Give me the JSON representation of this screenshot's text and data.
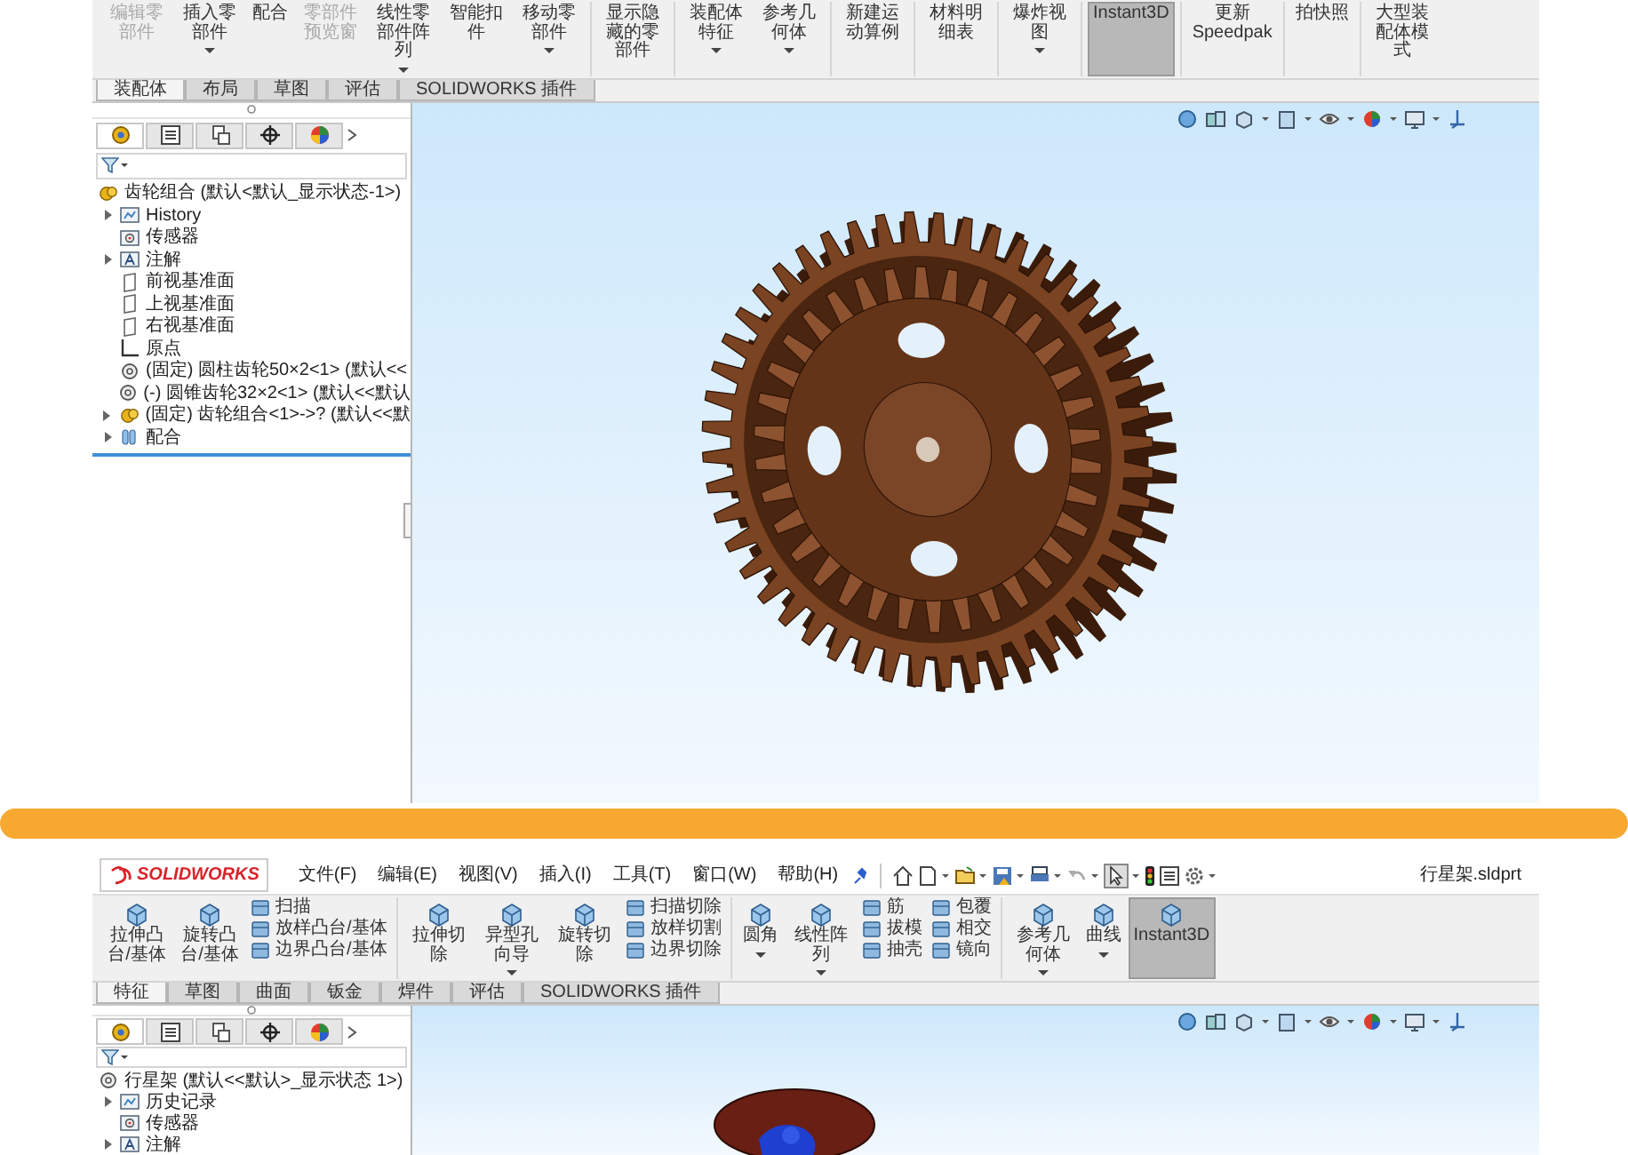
{
  "assembly_window": {
    "toolbar_groups": [
      [
        {
          "label": "编辑零部件",
          "disabled": true,
          "selected": false,
          "dropdown": false
        },
        {
          "label": "插入零部件",
          "disabled": false,
          "selected": false,
          "dropdown": true
        },
        {
          "label": "配合",
          "disabled": false,
          "selected": false,
          "dropdown": false
        },
        {
          "label": "零部件预览窗",
          "disabled": true,
          "selected": false,
          "dropdown": false
        },
        {
          "label": "线性零部件阵列",
          "disabled": false,
          "selected": false,
          "dropdown": true
        },
        {
          "label": "智能扣件",
          "disabled": false,
          "selected": false,
          "dropdown": false
        },
        {
          "label": "移动零部件",
          "disabled": false,
          "selected": false,
          "dropdown": true
        }
      ],
      [
        {
          "label": "显示隐藏的零部件",
          "disabled": false,
          "selected": false,
          "dropdown": false
        }
      ],
      [
        {
          "label": "装配体特征",
          "disabled": false,
          "selected": false,
          "dropdown": true
        },
        {
          "label": "参考几何体",
          "disabled": false,
          "selected": false,
          "dropdown": true
        }
      ],
      [
        {
          "label": "新建运动算例",
          "disabled": false,
          "selected": false,
          "dropdown": false
        }
      ],
      [
        {
          "label": "材料明细表",
          "disabled": false,
          "selected": false,
          "dropdown": false
        }
      ],
      [
        {
          "label": "爆炸视图",
          "disabled": false,
          "selected": false,
          "dropdown": true
        }
      ],
      [
        {
          "label": "Instant3D",
          "disabled": false,
          "selected": true,
          "dropdown": false
        }
      ],
      [
        {
          "label": "更新Speedpak",
          "disabled": false,
          "selected": false,
          "dropdown": false
        }
      ],
      [
        {
          "label": "拍快照",
          "disabled": false,
          "selected": false,
          "dropdown": false
        }
      ],
      [
        {
          "label": "大型装配体模式",
          "disabled": false,
          "selected": false,
          "dropdown": false
        }
      ]
    ],
    "tabs": [
      {
        "label": "装配体",
        "selected": true
      },
      {
        "label": "布局",
        "selected": false
      },
      {
        "label": "草图",
        "selected": false
      },
      {
        "label": "评估",
        "selected": false
      },
      {
        "label": "SOLIDWORKS 插件",
        "selected": false
      }
    ],
    "panel_tabs": [
      {
        "selected": true
      },
      {
        "selected": false
      },
      {
        "selected": false
      },
      {
        "selected": false
      },
      {
        "selected": false
      }
    ],
    "tree": {
      "root": {
        "label": "齿轮组合 (默认<默认_显示状态-1>)",
        "kind": "assembly"
      },
      "items": [
        {
          "label": "History",
          "kind": "folder",
          "expandable": true
        },
        {
          "label": "传感器",
          "kind": "sensor",
          "expandable": false
        },
        {
          "label": "注解",
          "kind": "annotation",
          "expandable": true
        },
        {
          "label": "前视基准面",
          "kind": "plane",
          "expandable": false
        },
        {
          "label": "上视基准面",
          "kind": "plane",
          "expandable": false
        },
        {
          "label": "右视基准面",
          "kind": "plane",
          "expandable": false
        },
        {
          "label": "原点",
          "kind": "origin",
          "expandable": false
        },
        {
          "label": "(固定) 圆柱齿轮50×2<1> (默认<<",
          "kind": "part",
          "expandable": false
        },
        {
          "label": "(-) 圆锥齿轮32×2<1> (默认<<默认",
          "kind": "part",
          "expandable": false
        },
        {
          "label": "(固定) 齿轮组合<1>->? (默认<<默",
          "kind": "assembly",
          "expandable": true
        },
        {
          "label": "配合",
          "kind": "mate",
          "expandable": true
        }
      ]
    }
  },
  "part_window": {
    "logo": "SOLIDWORKS",
    "menu": [
      "文件(F)",
      "编辑(E)",
      "视图(V)",
      "插入(I)",
      "工具(T)",
      "窗口(W)",
      "帮助(H)"
    ],
    "file_name": "行星架.sldprt",
    "toolbar_groups": [
      [
        {
          "kind": "large",
          "label": "拉伸凸台/基体",
          "dropdown": false,
          "selected": false
        },
        {
          "kind": "large",
          "label": "旋转凸台/基体",
          "dropdown": false,
          "selected": false
        },
        {
          "kind": "stack",
          "items": [
            "扫描",
            "放样凸台/基体",
            "边界凸台/基体"
          ]
        }
      ],
      [
        {
          "kind": "large",
          "label": "拉伸切除",
          "dropdown": false,
          "selected": false
        },
        {
          "kind": "large",
          "label": "异型孔向导",
          "dropdown": true,
          "selected": false
        },
        {
          "kind": "large",
          "label": "旋转切除",
          "dropdown": false,
          "selected": false
        },
        {
          "kind": "stack",
          "items": [
            "扫描切除",
            "放样切割",
            "边界切除"
          ]
        }
      ],
      [
        {
          "kind": "large",
          "label": "圆角",
          "dropdown": true,
          "selected": false
        },
        {
          "kind": "large",
          "label": "线性阵列",
          "dropdown": true,
          "selected": false
        },
        {
          "kind": "stack",
          "items": [
            "筋",
            "拔模",
            "抽壳"
          ]
        },
        {
          "kind": "stack",
          "items": [
            "包覆",
            "相交",
            "镜向"
          ]
        }
      ],
      [
        {
          "kind": "large",
          "label": "参考几何体",
          "dropdown": true,
          "selected": false
        },
        {
          "kind": "large",
          "label": "曲线",
          "dropdown": true,
          "selected": false
        },
        {
          "kind": "large",
          "label": "Instant3D",
          "dropdown": false,
          "selected": true
        }
      ]
    ],
    "tabs": [
      {
        "label": "特征",
        "selected": true
      },
      {
        "label": "草图",
        "selected": false
      },
      {
        "label": "曲面",
        "selected": false
      },
      {
        "label": "钣金",
        "selected": false
      },
      {
        "label": "焊件",
        "selected": false
      },
      {
        "label": "评估",
        "selected": false
      },
      {
        "label": "SOLIDWORKS 插件",
        "selected": false
      }
    ],
    "panel_tabs": [
      {
        "selected": true
      },
      {
        "selected": false
      },
      {
        "selected": false
      },
      {
        "selected": false
      },
      {
        "selected": false
      }
    ],
    "tree": {
      "root": {
        "label": "行星架 (默认<<默认>_显示状态 1>)",
        "kind": "part"
      },
      "items": [
        {
          "label": "历史记录",
          "kind": "folder",
          "expandable": true
        },
        {
          "label": "传感器",
          "kind": "sensor",
          "expandable": false
        },
        {
          "label": "注解",
          "kind": "annotation",
          "expandable": true
        }
      ]
    }
  }
}
